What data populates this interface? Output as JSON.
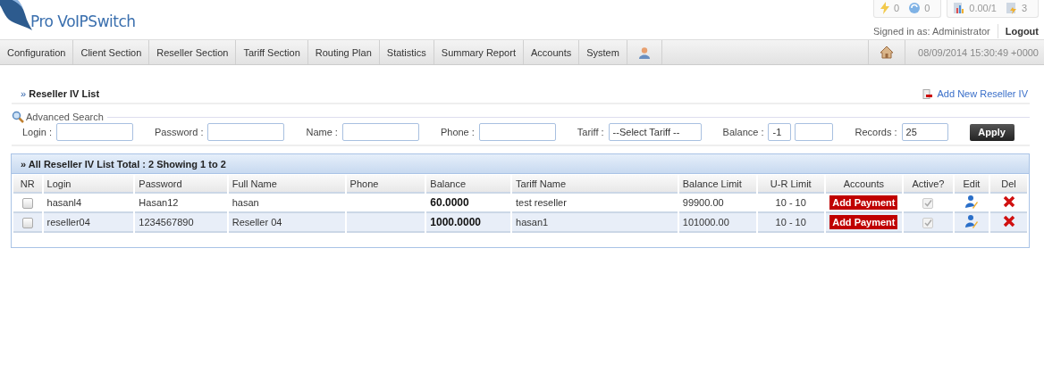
{
  "header": {
    "logo": "Pro VoIPSwitch",
    "stats": [
      {
        "kind": "bolt",
        "value": "0"
      },
      {
        "kind": "sync",
        "value": "0"
      },
      {
        "kind": "chart",
        "value": "0.00/1"
      },
      {
        "kind": "doc",
        "value": "3"
      }
    ],
    "signed_in": "Signed in as: Administrator",
    "logout": "Logout"
  },
  "nav": {
    "items": [
      {
        "label": "Configuration"
      },
      {
        "label": "Client Section"
      },
      {
        "label": "Reseller Section"
      },
      {
        "label": "Tariff Section"
      },
      {
        "label": "Routing Plan"
      },
      {
        "label": "Statistics"
      },
      {
        "label": "Summary Report"
      },
      {
        "label": "Accounts"
      },
      {
        "label": "System"
      }
    ],
    "datetime": "08/09/2014 15:30:49 +0000"
  },
  "page": {
    "title": "» **Reseller IV List**",
    "add_link": "Add New Reseller IV"
  },
  "search": {
    "legend": "Advanced Search",
    "fields": [
      {
        "kind": "text",
        "label": "Login :"
      },
      {
        "kind": "text",
        "label": "Password :"
      },
      {
        "kind": "text",
        "label": "Name :"
      },
      {
        "kind": "text",
        "label": "Phone :"
      },
      {
        "kind": "select",
        "label": "Tariff :",
        "value": "--Select Tariff --"
      },
      {
        "kind": "range",
        "label": "Balance :",
        "value": "-1"
      },
      {
        "kind": "text",
        "label": "Records :",
        "value": "25"
      }
    ],
    "apply": "Apply"
  },
  "table": {
    "title": "» All Reseller IV List Total : 2 Showing 1 to 2",
    "columns": [
      "NR",
      "Login",
      "Password",
      "Full Name",
      "Phone",
      "Balance",
      "Tariff Name",
      "Balance Limit",
      "U-R Limit",
      "Accounts",
      "Active?",
      "Edit",
      "Del"
    ],
    "rows": [
      {
        "checked": false,
        "login": "hasanl4",
        "password": "Hasan12",
        "full_name": "hasan",
        "balance": "60.0000",
        "tariff": "test reseller",
        "balance_limit": "99900.00",
        "ur_limit": "10 - 10",
        "action": "Add Payment",
        "active": true
      },
      {
        "checked": false,
        "login": "reseller04",
        "password": "1234567890",
        "full_name": "Reseller 04",
        "balance": "1000.0000",
        "tariff": "hasan1",
        "balance_limit": "101000.00",
        "ur_limit": "10 - 10",
        "action": "Add Payment",
        "active": true
      }
    ]
  }
}
